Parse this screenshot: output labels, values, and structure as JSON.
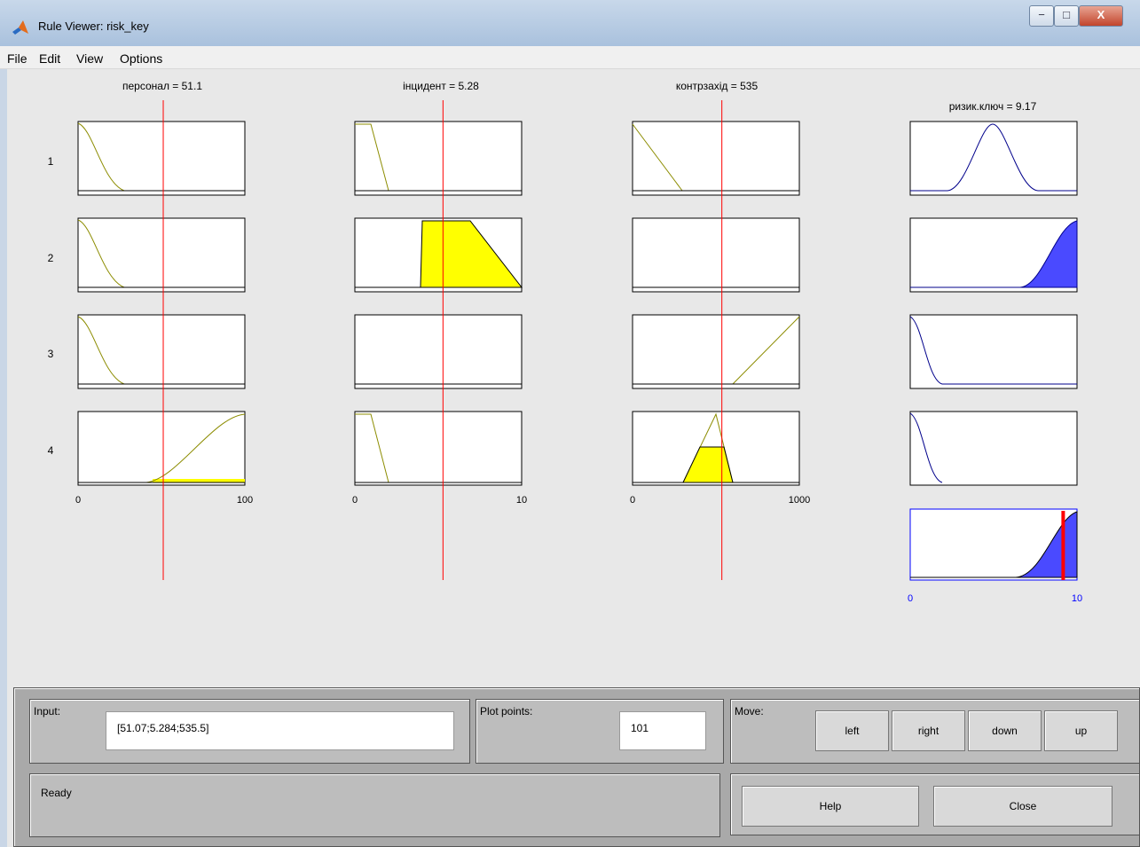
{
  "window": {
    "title": "Rule Viewer: risk_key",
    "minimize_glyph": "−",
    "restore_glyph": "□",
    "close_glyph": "X"
  },
  "menu": [
    "File",
    "Edit",
    "View",
    "Options"
  ],
  "rules": {
    "row_labels": [
      "1",
      "2",
      "3",
      "4"
    ]
  },
  "inputs": [
    {
      "title": "персонал = 51.1",
      "range": [
        0,
        100
      ],
      "value": 51.07,
      "ticks": [
        "0",
        "100"
      ]
    },
    {
      "title": "інцидент = 5.28",
      "range": [
        0,
        10
      ],
      "value": 5.284,
      "ticks": [
        "0",
        "10"
      ]
    },
    {
      "title": "контрзахід = 535",
      "range": [
        0,
        1000
      ],
      "value": 535.5,
      "ticks": [
        "0",
        "1000"
      ]
    }
  ],
  "output": {
    "title": "ризик.ключ = 9.17",
    "range": [
      0,
      10
    ],
    "value": 9.17,
    "ticks": [
      "0",
      "10"
    ]
  },
  "colors": {
    "input_mf": "#8c8c00",
    "fired_input": "#ffff00",
    "output_mf": "#00008b",
    "fired_output": "#4a4aff",
    "value_line": "#ff0000",
    "aggregate_axis": "#0000ff"
  },
  "controls": {
    "input_label": "Input:",
    "input_value": "[51.07;5.284;535.5]",
    "plot_points_label": "Plot points:",
    "plot_points_value": "101",
    "move_label": "Move:",
    "move_buttons": [
      "left",
      "right",
      "down",
      "up"
    ],
    "help_label": "Help",
    "close_label": "Close",
    "status": "Ready"
  }
}
